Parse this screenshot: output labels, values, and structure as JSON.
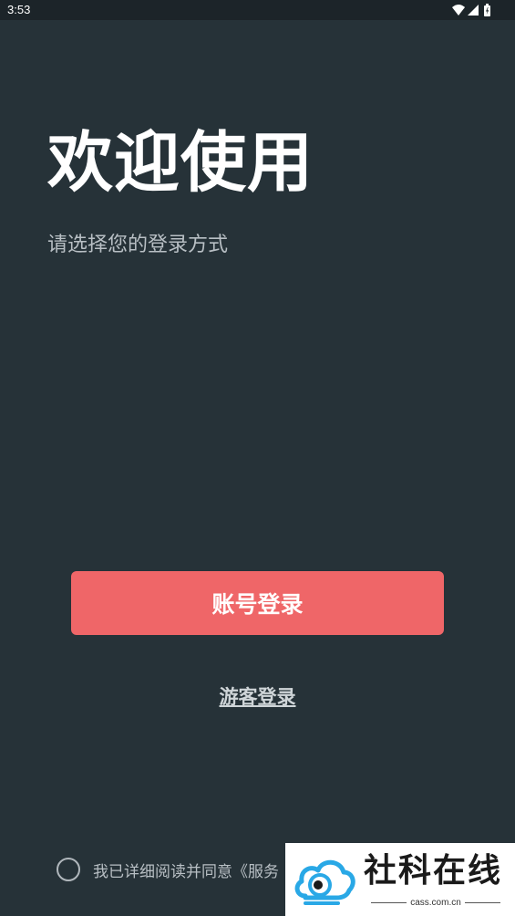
{
  "status_bar": {
    "time": "3:53",
    "icons": [
      "wifi-icon",
      "cellular-signal-icon",
      "battery-charging-icon"
    ]
  },
  "welcome": {
    "title": "欢迎使用",
    "subtitle": "请选择您的登录方式"
  },
  "actions": {
    "account_login_label": "账号登录",
    "guest_login_label": "游客登录"
  },
  "agreement": {
    "checked": false,
    "text": "我已详细阅读并同意《服务"
  },
  "watermark": {
    "brand": "社科在线",
    "domain": "cass.com.cn"
  },
  "colors": {
    "background": "#263238",
    "primary_button": "#ef6668",
    "secondary_text": "#b8bfc4",
    "watermark_logo_blue": "#29a8e6"
  }
}
